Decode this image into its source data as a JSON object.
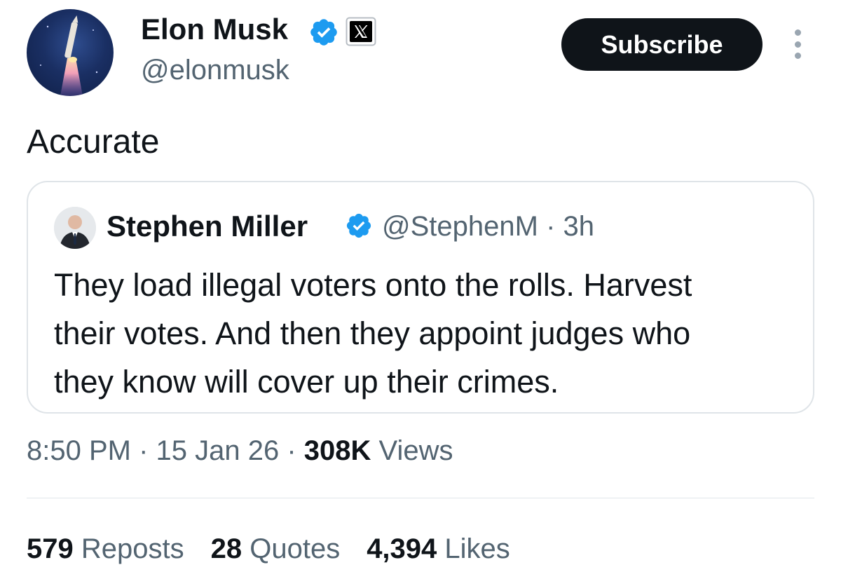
{
  "author": {
    "name": "Elon Musk",
    "handle": "@elonmusk",
    "avatar_icon": "rocket-launch-avatar",
    "verified_icon": "verified-badge-icon",
    "affiliation_icon": "x-logo-icon"
  },
  "subscribe_label": "Subscribe",
  "more_icon": "vertical-ellipsis-icon",
  "tweet": {
    "text": "Accurate"
  },
  "quote": {
    "name": "Stephen Miller",
    "handle": "@StephenM",
    "separator": " · ",
    "time": "3h",
    "lines": [
      "They load illegal voters onto the rolls. Harvest",
      "their votes. And then they appoint judges who",
      "they know will cover up their crimes."
    ]
  },
  "meta": {
    "time": "8:50 PM",
    "separator": " · ",
    "date": "15 Jan 26",
    "views_count": "308K",
    "views_label": " Views"
  },
  "stats": {
    "reposts_count": "579",
    "reposts_label": " Reposts",
    "quotes_count": "28",
    "quotes_label": " Quotes",
    "likes_count": "4,394",
    "likes_label": " Likes"
  },
  "colors": {
    "verified": "#1d9bf0",
    "text_primary": "#0f1419",
    "text_secondary": "#536471",
    "button_bg": "#0f1419",
    "border": "#dfe4e8"
  }
}
